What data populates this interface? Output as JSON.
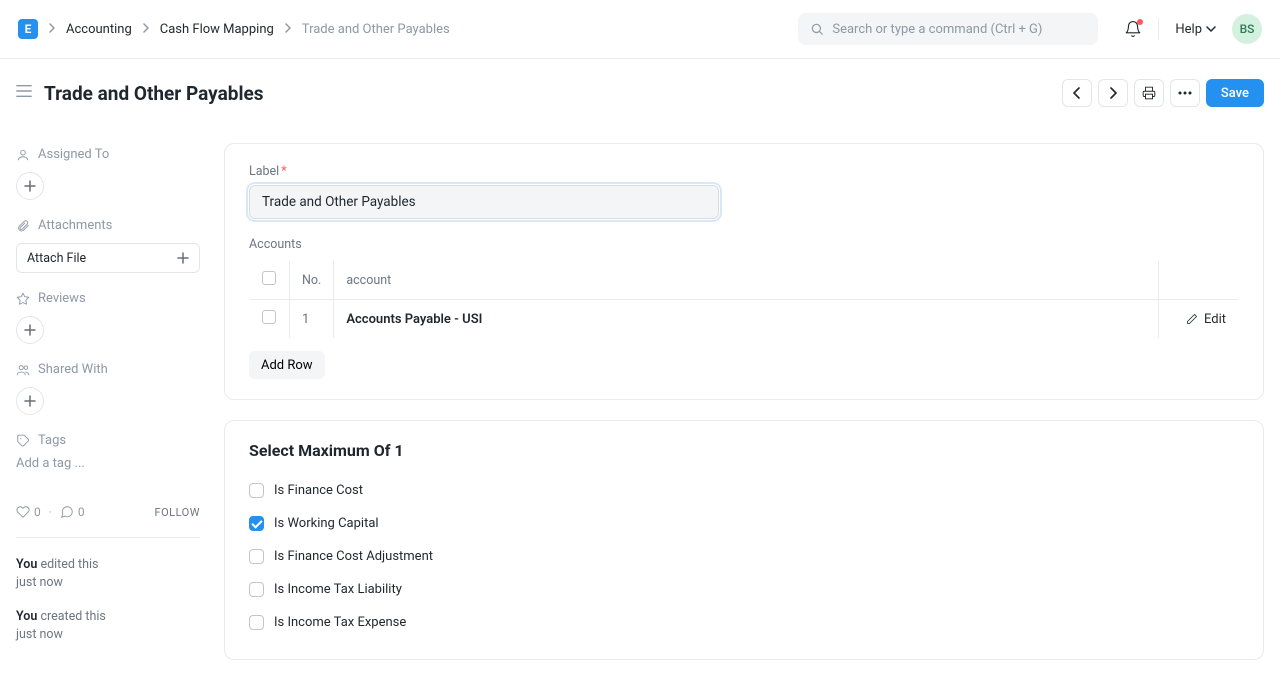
{
  "logo": "E",
  "breadcrumb": {
    "items": [
      "Accounting",
      "Cash Flow Mapping"
    ],
    "current": "Trade and Other Payables"
  },
  "search": {
    "placeholder": "Search or type a command (Ctrl + G)"
  },
  "help": {
    "label": "Help"
  },
  "avatar": "BS",
  "page": {
    "title": "Trade and Other Payables",
    "save_label": "Save"
  },
  "sidebar": {
    "assigned_to": "Assigned To",
    "attachments": "Attachments",
    "attach_file": "Attach File",
    "reviews": "Reviews",
    "shared_with": "Shared With",
    "tags": "Tags",
    "add_tag": "Add a tag ...",
    "likes": "0",
    "comments": "0",
    "follow": "FOLLOW",
    "activity": [
      {
        "who": "You",
        "what": "edited this",
        "when": "just now"
      },
      {
        "who": "You",
        "what": "created this",
        "when": "just now"
      }
    ]
  },
  "form": {
    "label_field": {
      "label": "Label",
      "value": "Trade and Other Payables",
      "required": true
    },
    "accounts": {
      "heading": "Accounts",
      "columns": {
        "no": "No.",
        "account": "account"
      },
      "rows": [
        {
          "no": "1",
          "account": "Accounts Payable - USI"
        }
      ],
      "edit_label": "Edit",
      "add_row": "Add Row"
    },
    "select_max": {
      "title": "Select Maximum Of 1",
      "options": [
        {
          "label": "Is Finance Cost",
          "checked": false
        },
        {
          "label": "Is Working Capital",
          "checked": true
        },
        {
          "label": "Is Finance Cost Adjustment",
          "checked": false
        },
        {
          "label": "Is Income Tax Liability",
          "checked": false
        },
        {
          "label": "Is Income Tax Expense",
          "checked": false
        }
      ]
    }
  }
}
